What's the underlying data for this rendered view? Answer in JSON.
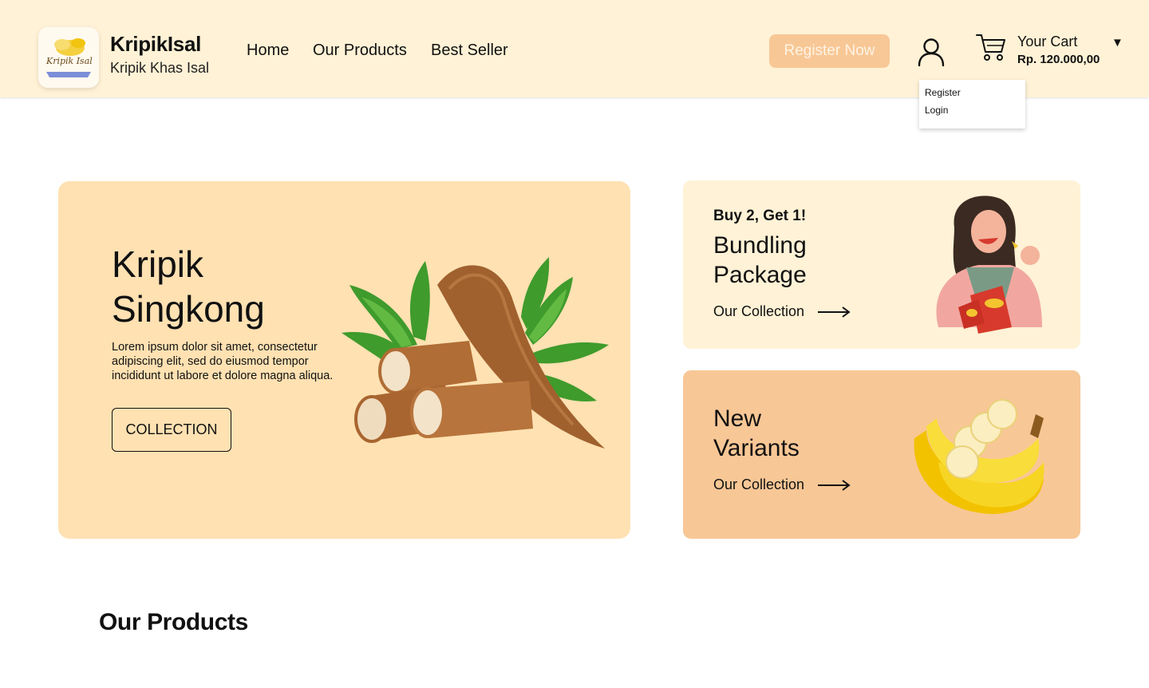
{
  "header": {
    "brand_name": "KripikIsal",
    "brand_tagline": "Kripik Khas Isal",
    "logo_text": "Kripik Isal",
    "nav": [
      "Home",
      "Our Products",
      "Best Seller"
    ],
    "register_button": "Register Now",
    "cart_label": "Your Cart",
    "cart_total": "Rp. 120.000,00",
    "caret": "▼"
  },
  "dropdown": {
    "items": [
      "Register",
      "Login"
    ]
  },
  "hero": {
    "title_line1": "Kripik",
    "title_line2": "Singkong",
    "description": "Lorem ipsum dolor sit amet, consectetur adipiscing elit, sed do eiusmod  tempor incididunt ut labore et dolore magna aliqua.",
    "button": "COLLECTION"
  },
  "promos": [
    {
      "kicker": "Buy 2, Get 1!",
      "title_line1": "Bundling",
      "title_line2": "Package",
      "link": "Our Collection"
    },
    {
      "title_line1": "New",
      "title_line2": "Variants",
      "link": "Our Collection"
    }
  ],
  "section_title": "Our Products",
  "colors": {
    "header_bg": "#fff2d6",
    "accent": "#f8c796",
    "hero_bg": "#ffe1b2"
  }
}
